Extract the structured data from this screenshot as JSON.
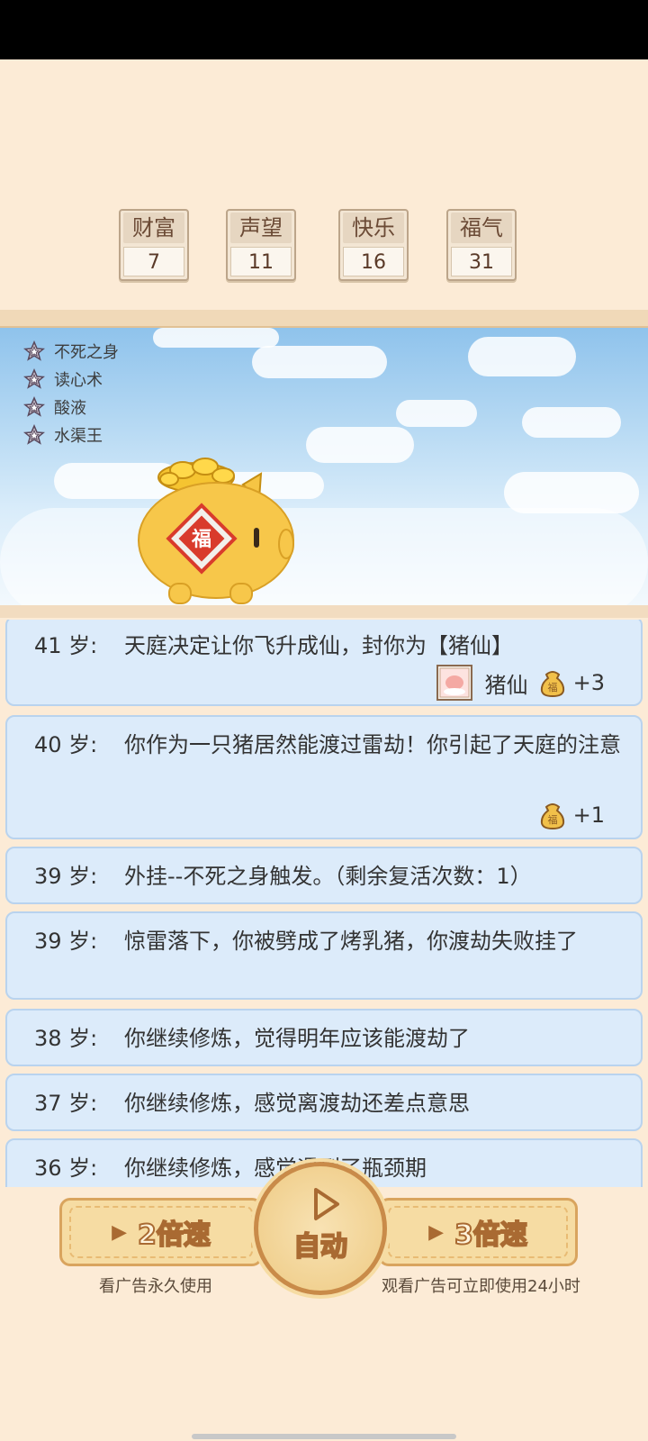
{
  "stats": [
    {
      "label": "财富",
      "value": "7"
    },
    {
      "label": "声望",
      "value": "11"
    },
    {
      "label": "快乐",
      "value": "16"
    },
    {
      "label": "福气",
      "value": "31"
    }
  ],
  "skills": [
    "不死之身",
    "读心术",
    "酸液",
    "水渠王"
  ],
  "pig_badge": "福",
  "log": [
    {
      "age": "41 岁:",
      "text": "天庭决定让你飞升成仙，封你为【猪仙】",
      "reward_title": "猪仙",
      "reward_value": "+3",
      "bag_char": "福"
    },
    {
      "age": "40 岁:",
      "text": "你作为一只猪居然能渡过雷劫！你引起了天庭的注意",
      "reward_value": "+1",
      "bag_char": "福"
    },
    {
      "age": "39 岁:",
      "text": "外挂--不死之身触发。（剩余复活次数：1）"
    },
    {
      "age": "39 岁:",
      "text": "惊雷落下，你被劈成了烤乳猪，你渡劫失败挂了"
    },
    {
      "age": "38 岁:",
      "text": "你继续修炼，觉得明年应该能渡劫了"
    },
    {
      "age": "37 岁:",
      "text": "你继续修炼，感觉离渡劫还差点意思"
    },
    {
      "age": "36 岁:",
      "text": "你继续修炼，感觉遇到了瓶颈期"
    }
  ],
  "controls": {
    "speed2_label": "2倍速",
    "speed2_hint": "看广告永久使用",
    "auto_label": "自动",
    "speed3_label": "3倍速",
    "speed3_hint": "观看广告可立即使用24小时"
  }
}
